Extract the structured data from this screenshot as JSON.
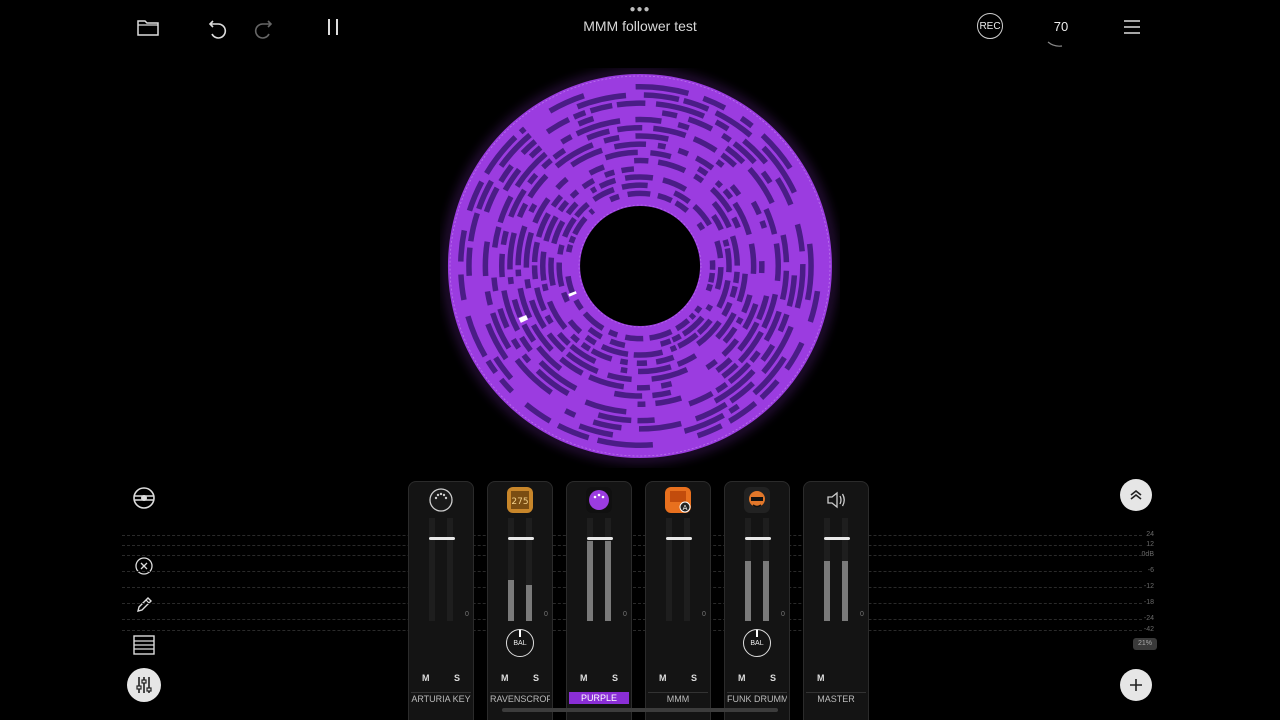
{
  "header": {
    "title": "MMM follower test",
    "rec_label": "REC",
    "tempo": "70"
  },
  "ring": {
    "color": "#9b3ce0",
    "block_color": "#4a1d86",
    "playhead_color": "#ffffff"
  },
  "mixer": {
    "db_labels": [
      "24",
      "12",
      "0dB",
      "-6",
      "-12",
      "-18",
      "-24",
      "-42"
    ],
    "bal_label": "BAL",
    "mute_label": "M",
    "solo_label": "S",
    "zero_label": "0",
    "cpu_label": "21%",
    "channels": [
      {
        "name": "ARTURIA KEY",
        "icon": "midi-port-icon",
        "selected": false,
        "meter": [
          0,
          0
        ],
        "bal": false,
        "solo": true
      },
      {
        "name": "RAVENSCROF",
        "icon": "piano-app-icon",
        "selected": false,
        "meter": [
          0.4,
          0.35
        ],
        "bal": true,
        "solo": true
      },
      {
        "name": "PURPLE",
        "icon": "purple-synth-icon",
        "selected": true,
        "meter": [
          0.78,
          0.78
        ],
        "bal": false,
        "solo": true
      },
      {
        "name": "MMM",
        "icon": "mmm-app-icon",
        "selected": false,
        "meter": [
          0,
          0
        ],
        "bal": false,
        "solo": true
      },
      {
        "name": "FUNK DRUMM",
        "icon": "drummer-app-icon",
        "selected": false,
        "meter": [
          0.58,
          0.58
        ],
        "bal": true,
        "solo": true
      },
      {
        "name": "MASTER",
        "icon": "speaker-icon",
        "selected": false,
        "meter": [
          0.58,
          0.58
        ],
        "bal": false,
        "solo": false
      }
    ]
  }
}
